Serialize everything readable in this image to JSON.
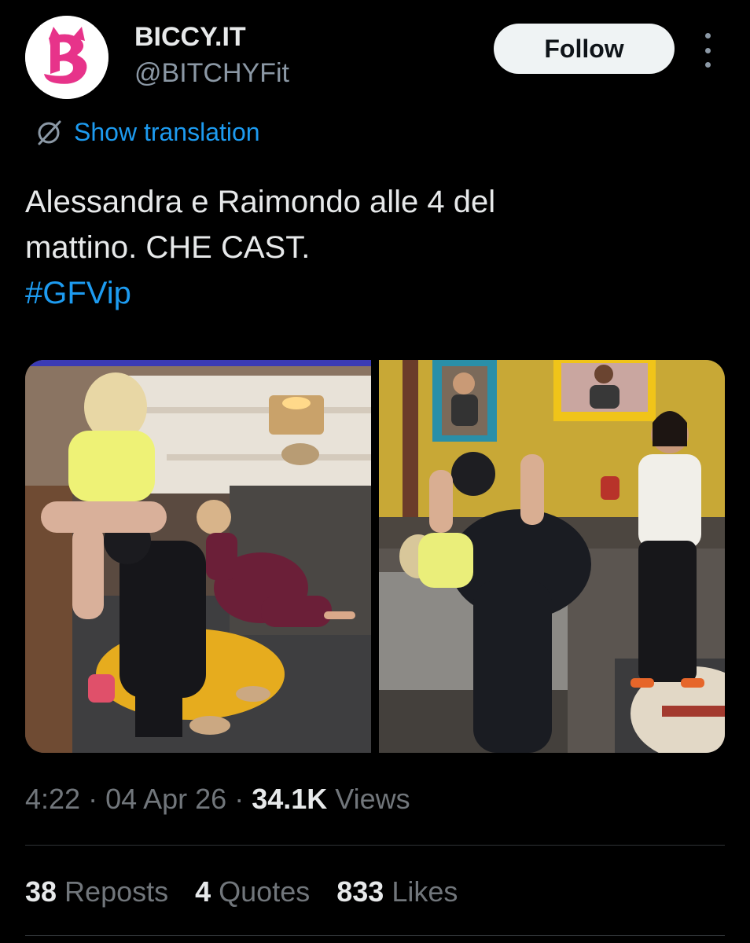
{
  "author": {
    "display_name": "BICCY.IT",
    "handle": "@BITCHYFit",
    "avatar_icon": "biccy-logo",
    "avatar_letter": "B"
  },
  "follow_label": "Follow",
  "more_icon": "more-vertical-icon",
  "translation": {
    "icon": "globe-slash-icon",
    "label": "Show translation"
  },
  "tweet": {
    "line1": "Alessandra e Raimondo alle 4 del",
    "line2": "mattino. CHE CAST.",
    "hashtag": "#GFVip"
  },
  "meta": {
    "time": "4:22",
    "sep1": " · ",
    "date": "04 Apr 26",
    "sep2": " · ",
    "views_count": "34.1K",
    "views_label": " Views"
  },
  "stats": [
    {
      "count": "38",
      "label": "Reposts"
    },
    {
      "count": "4",
      "label": "Quotes"
    },
    {
      "count": "833",
      "label": "Likes"
    }
  ],
  "colors": {
    "background": "#000000",
    "accent": "#1d9bf0",
    "secondary_text": "#71767b",
    "brand_pink": "#e7338a"
  }
}
